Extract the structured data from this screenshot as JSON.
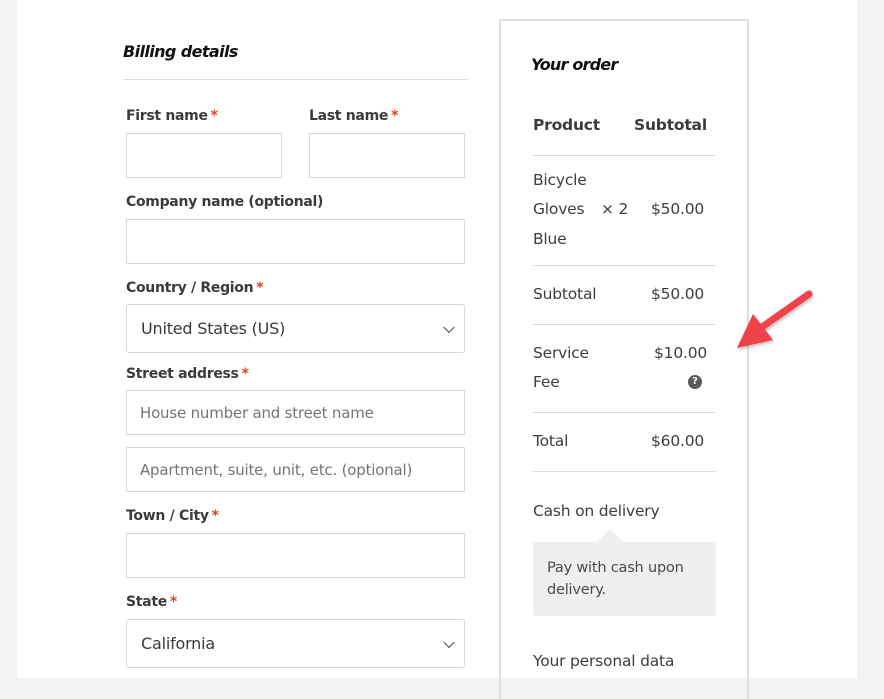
{
  "billing": {
    "title": "Billing details",
    "required_marker": "*",
    "fields": {
      "first_name": {
        "label": "First name",
        "value": ""
      },
      "last_name": {
        "label": "Last name",
        "value": ""
      },
      "company": {
        "label": "Company name (optional)",
        "value": ""
      },
      "country": {
        "label": "Country / Region",
        "selected": "United States (US)"
      },
      "street": {
        "label": "Street address",
        "line1_placeholder": "House number and street name",
        "line2_placeholder": "Apartment, suite, unit, etc. (optional)"
      },
      "city": {
        "label": "Town / City",
        "value": ""
      },
      "state": {
        "label": "State",
        "selected": "California"
      }
    }
  },
  "order": {
    "title": "Your order",
    "headers": {
      "product": "Product",
      "subtotal": "Subtotal"
    },
    "items": [
      {
        "name_lines": [
          "Bicycle",
          "Gloves",
          "Blue"
        ],
        "quantity": "× 2",
        "total": "$50.00"
      }
    ],
    "subtotal": {
      "label": "Subtotal",
      "value": "$50.00"
    },
    "fee": {
      "label_lines": [
        "Service",
        "Fee"
      ],
      "value": "$10.00",
      "help_icon": "question-circle-icon",
      "help_glyph": "?"
    },
    "total": {
      "label": "Total",
      "value": "$60.00"
    },
    "payment": {
      "method": "Cash on delivery",
      "description": "Pay with cash upon delivery."
    },
    "personal_data_heading": "Your personal data"
  },
  "annotation": {
    "type": "arrow",
    "color": "#f0424a",
    "points_to": "service-fee"
  }
}
